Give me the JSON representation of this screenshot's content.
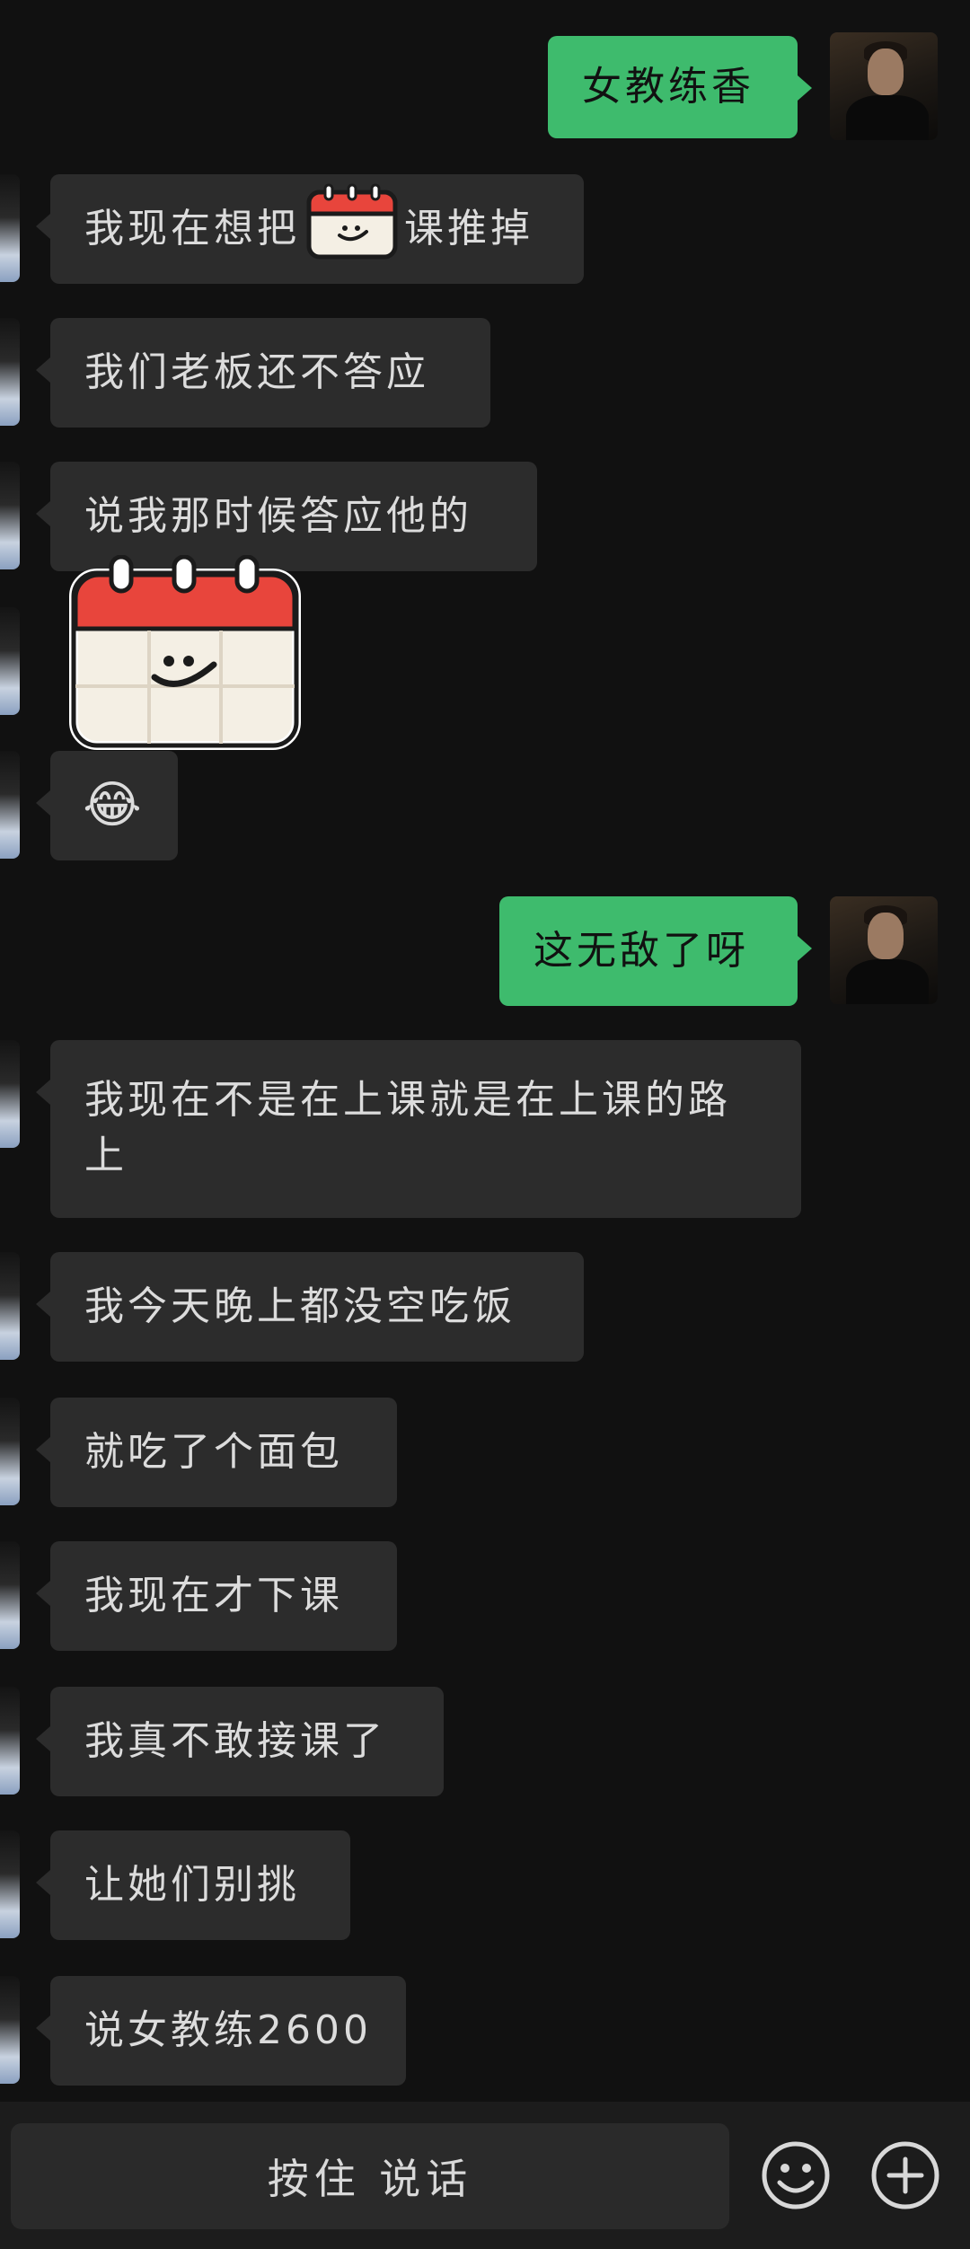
{
  "messages": [
    {
      "side": "out",
      "text": "女教练香"
    },
    {
      "side": "in",
      "text_before": "我现在想把",
      "text_after": "课推掉",
      "emoji": "calendar-emoji"
    },
    {
      "side": "in",
      "text": "我们老板还不答应"
    },
    {
      "side": "in",
      "text": "说我那时候答应他的"
    },
    {
      "side": "in",
      "sticker": "calendar-sticker"
    },
    {
      "side": "in",
      "text": "😂"
    },
    {
      "side": "out",
      "text": "这无敌了呀"
    },
    {
      "side": "in",
      "text": "我现在不是在上课就是在上课的路上"
    },
    {
      "side": "in",
      "text": "我今天晚上都没空吃饭"
    },
    {
      "side": "in",
      "text": "就吃了个面包"
    },
    {
      "side": "in",
      "text": "我现在才下课"
    },
    {
      "side": "in",
      "text": "我真不敢接课了"
    },
    {
      "side": "in",
      "text": "让她们别挑"
    },
    {
      "side": "in",
      "text": "说女教练2600"
    }
  ],
  "input_bar": {
    "hold_to_talk": "按住 说话",
    "emoji_icon": "smiley-icon",
    "plus_icon": "plus-icon"
  },
  "colors": {
    "background": "#111111",
    "incoming_bubble": "#2c2c2c",
    "outgoing_bubble": "#3ebb6d"
  }
}
